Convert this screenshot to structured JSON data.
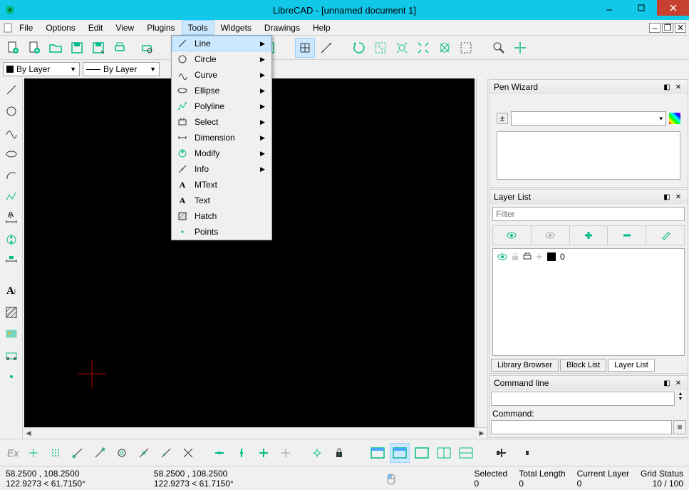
{
  "window": {
    "title": "LibreCAD - [unnamed document 1]"
  },
  "menu": {
    "items": [
      "File",
      "Options",
      "Edit",
      "View",
      "Plugins",
      "Tools",
      "Widgets",
      "Drawings",
      "Help"
    ],
    "open_index": 5
  },
  "tools_menu": {
    "items": [
      {
        "icon": "line",
        "label": "Line",
        "sub": true
      },
      {
        "icon": "circle",
        "label": "Circle",
        "sub": true
      },
      {
        "icon": "curve",
        "label": "Curve",
        "sub": true
      },
      {
        "icon": "ellipse",
        "label": "Ellipse",
        "sub": true
      },
      {
        "icon": "polyline",
        "label": "Polyline",
        "sub": true
      },
      {
        "icon": "select",
        "label": "Select",
        "sub": true
      },
      {
        "icon": "dimension",
        "label": "Dimension",
        "sub": true
      },
      {
        "icon": "modify",
        "label": "Modify",
        "sub": true
      },
      {
        "icon": "info",
        "label": "Info",
        "sub": true
      },
      {
        "icon": "mtext",
        "label": "MText",
        "sub": false
      },
      {
        "icon": "text",
        "label": "Text",
        "sub": false
      },
      {
        "icon": "hatch",
        "label": "Hatch",
        "sub": false
      },
      {
        "icon": "points",
        "label": "Points",
        "sub": false
      }
    ]
  },
  "layer_combo": {
    "color": "By Layer",
    "linetype": "By Layer"
  },
  "panels": {
    "pen_wizard": {
      "title": "Pen Wizard"
    },
    "layer_list": {
      "title": "Layer List",
      "filter_placeholder": "Filter",
      "rows": [
        {
          "name": "0"
        }
      ],
      "tabs": [
        "Library Browser",
        "Block List",
        "Layer List"
      ],
      "active_tab": 2
    },
    "cmd": {
      "title": "Command line",
      "label": "Command:"
    }
  },
  "status": {
    "abs": "58.2500 , 108.2500",
    "polar": "122.9273 < 61.7150°",
    "abs2": "58.2500 , 108.2500",
    "polar2": "122.9273 < 61.7150°",
    "sel_label": "Selected",
    "sel_val": "0",
    "len_label": "Total Length",
    "len_val": "0",
    "layer_label": "Current Layer",
    "layer_val": "0",
    "grid_label": "Grid Status",
    "grid_val": "10 / 100"
  },
  "bottom_label": "Ex"
}
